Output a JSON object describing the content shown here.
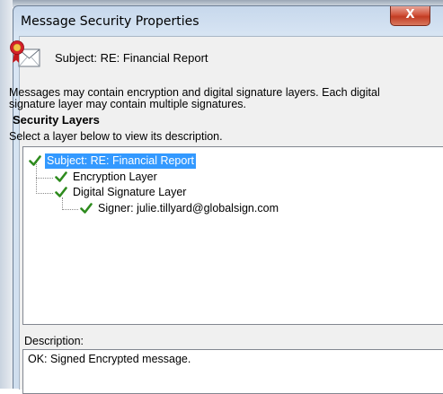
{
  "window": {
    "title": "Message Security Properties",
    "close_glyph": "X"
  },
  "header": {
    "icon": "certificate-envelope-icon",
    "subject": "Subject:  RE: Financial Report"
  },
  "info": {
    "line1": "Messages may contain encryption and digital signature layers. Each digital",
    "line2": "signature layer may contain multiple signatures."
  },
  "security_layers": {
    "title": "Security Layers",
    "instruction": "Select a layer below to view its description.",
    "items": [
      {
        "label": "Subject: RE: Financial Report",
        "selected": true,
        "status": "check-icon"
      },
      {
        "label": "Encryption Layer",
        "selected": false,
        "status": "check-icon"
      },
      {
        "label": "Digital Signature Layer",
        "selected": false,
        "status": "check-icon"
      },
      {
        "label": "Signer: julie.tillyard@globalsign.com",
        "selected": false,
        "status": "check-icon"
      }
    ]
  },
  "description": {
    "label": "Description:",
    "value": "OK: Signed Encrypted message."
  },
  "colors": {
    "selection": "#3399ff",
    "check": "#2e8b1e",
    "close_button": "#c94a30"
  }
}
